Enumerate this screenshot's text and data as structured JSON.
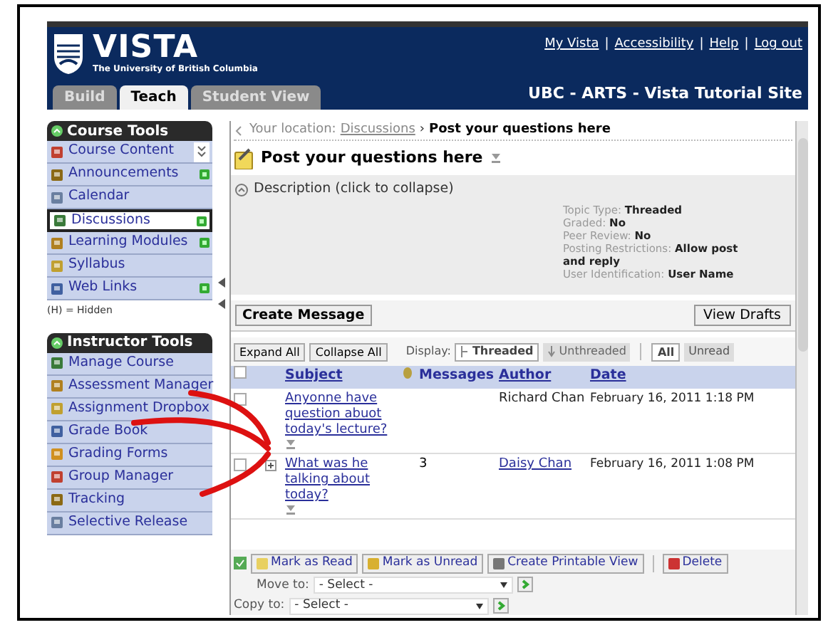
{
  "header": {
    "logo_title": "VISTA",
    "logo_subtitle": "The University of British Columbia",
    "links": [
      "My Vista",
      "Accessibility",
      "Help",
      "Log out"
    ],
    "link_separator": "|",
    "tabs": [
      {
        "label": "Build",
        "selected": false
      },
      {
        "label": "Teach",
        "selected": true
      },
      {
        "label": "Student View",
        "selected": false
      }
    ],
    "site_title": "UBC - ARTS - Vista Tutorial Site"
  },
  "sidebar": {
    "sections": [
      {
        "title": "Course Tools",
        "items": [
          {
            "label": "Course Content",
            "selected": false,
            "has_new": false,
            "collapse_toggle": true
          },
          {
            "label": "Announcements",
            "selected": false,
            "has_new": true,
            "collapse_toggle": false
          },
          {
            "label": "Calendar",
            "selected": false,
            "has_new": false,
            "collapse_toggle": false
          },
          {
            "label": "Discussions",
            "selected": true,
            "has_new": true,
            "collapse_toggle": false
          },
          {
            "label": "Learning Modules",
            "selected": false,
            "has_new": true,
            "collapse_toggle": false
          },
          {
            "label": "Syllabus",
            "selected": false,
            "has_new": false,
            "collapse_toggle": false
          },
          {
            "label": "Web Links",
            "selected": false,
            "has_new": true,
            "collapse_toggle": false
          }
        ],
        "note": "(H) = Hidden"
      },
      {
        "title": "Instructor Tools",
        "items": [
          {
            "label": "Manage Course",
            "selected": false,
            "has_new": false,
            "collapse_toggle": false
          },
          {
            "label": "Assessment Manager",
            "selected": false,
            "has_new": false,
            "collapse_toggle": false
          },
          {
            "label": "Assignment Dropbox",
            "selected": false,
            "has_new": false,
            "collapse_toggle": false
          },
          {
            "label": "Grade Book",
            "selected": false,
            "has_new": false,
            "collapse_toggle": false
          },
          {
            "label": "Grading Forms",
            "selected": false,
            "has_new": false,
            "collapse_toggle": false
          },
          {
            "label": "Group Manager",
            "selected": false,
            "has_new": false,
            "collapse_toggle": false
          },
          {
            "label": "Tracking",
            "selected": false,
            "has_new": false,
            "collapse_toggle": false
          },
          {
            "label": "Selective Release",
            "selected": false,
            "has_new": false,
            "collapse_toggle": false
          }
        ]
      }
    ]
  },
  "breadcrumb": {
    "prefix": "Your location:",
    "link": "Discussions",
    "separator": "›",
    "current": "Post your questions here"
  },
  "topic": {
    "title": "Post your questions here",
    "description_toggle": "Description (click to collapse)",
    "details": [
      {
        "label": "Topic Type:",
        "value": "Threaded"
      },
      {
        "label": "Graded:",
        "value": "No"
      },
      {
        "label": "Peer Review:",
        "value": "No"
      },
      {
        "label": "Posting Restrictions:",
        "value": "Allow post and reply"
      },
      {
        "label": "User Identification:",
        "value": "User Name"
      }
    ]
  },
  "actions": {
    "create": "Create Message",
    "drafts": "View Drafts"
  },
  "toolbar": {
    "expand": "Expand All",
    "collapse": "Collapse All",
    "display_label": "Display:",
    "display_options": [
      {
        "label": "Threaded",
        "selected": true
      },
      {
        "label": "Unthreaded",
        "selected": false
      }
    ],
    "filters": [
      {
        "label": "All",
        "selected": true
      },
      {
        "label": "Unread",
        "selected": false
      }
    ]
  },
  "table": {
    "select_all_checked": false,
    "columns": [
      "Subject",
      "Messages",
      "Author",
      "Date"
    ],
    "rows": [
      {
        "subject": "Anyonne have question abuot today's lecture?",
        "messages": "",
        "author": "Richard Chan",
        "author_is_link": false,
        "date": "February 16, 2011 1:18 PM",
        "expandable": false,
        "checked": false
      },
      {
        "subject": "What was he talking about today?",
        "messages": "3",
        "author": "Daisy Chan",
        "author_is_link": true,
        "date": "February 16, 2011 1:08 PM",
        "expandable": true,
        "checked": false
      }
    ]
  },
  "bulk_actions": [
    "Mark as Read",
    "Mark as Unread",
    "Create Printable View",
    "Delete"
  ],
  "move_to": {
    "label": "Move to:",
    "value": "- Select -"
  },
  "copy_to": {
    "label": "Copy to:",
    "value": "- Select -"
  }
}
